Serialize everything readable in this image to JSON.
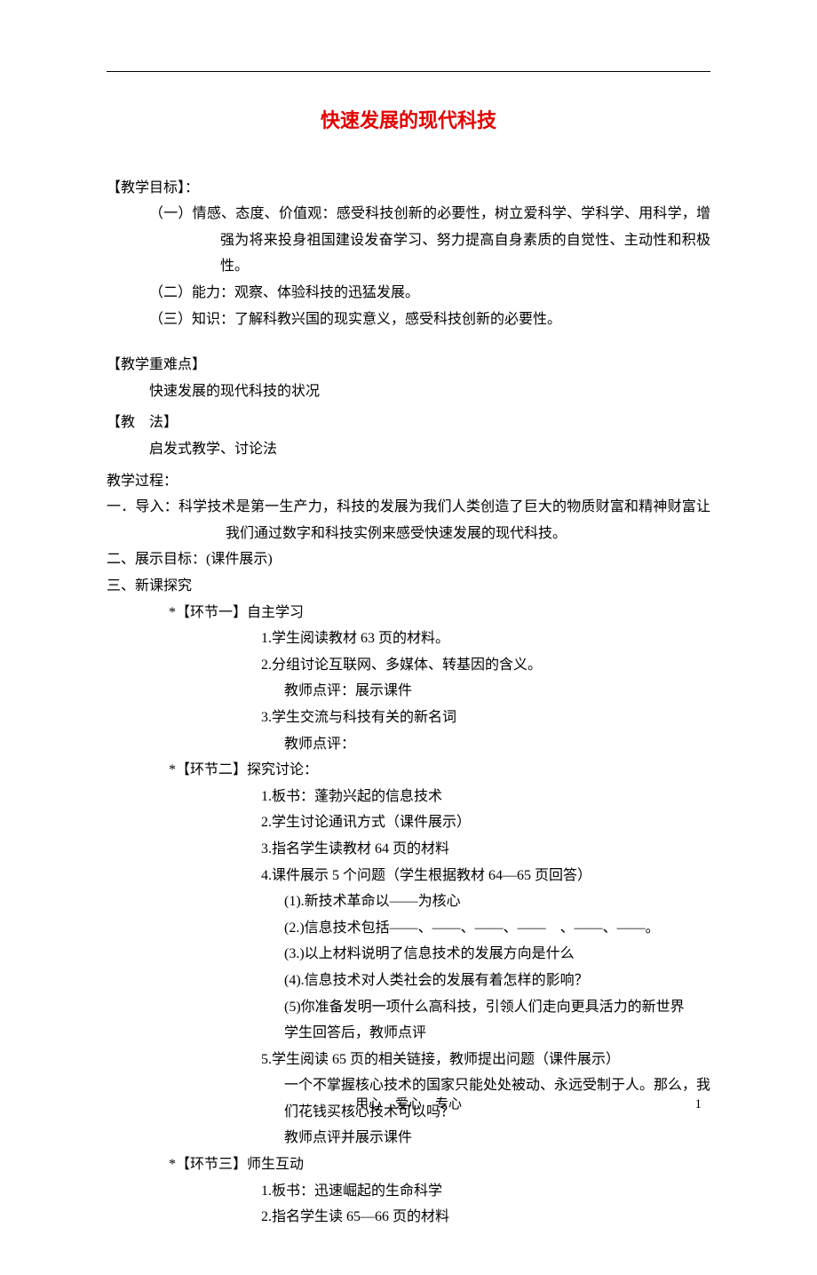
{
  "title": "快速发展的现代科技",
  "sections": {
    "goals_head": "【教学目标】：",
    "goal1": "（一）情感、态度、价值观：感受科技创新的必要性，树立爱科学、学科学、用科学，增强为将来投身祖国建设发奋学习、努力提高自身素质的自觉性、主动性和积极性。",
    "goal2": "（二）能力：观察、体验科技的迅猛发展。",
    "goal3": "（三）知识：了解科教兴国的现实意义，感受科技创新的必要性。",
    "difficulty_head": "【教学重难点】",
    "difficulty_body": "快速发展的现代科技的状况",
    "method_head": "【教　法】",
    "method_body": "启发式教学、讨论法",
    "process_head": "教学过程：",
    "intro": "一．导入：科学技术是第一生产力，科技的发展为我们人类创造了巨大的物质财富和精神财富让我们通过数字和科技实例来感受快速发展的现代科技。",
    "show_target": "二、展示目标：(课件展示)",
    "explore_head": "三、新课探究",
    "part1_head": "*【环节一】自主学习",
    "p1_1": "1.学生阅读教材 63 页的材料。",
    "p1_2": "2.分组讨论互联网、多媒体、转基因的含义。",
    "p1_2a": "教师点评：展示课件",
    "p1_3": "3.学生交流与科技有关的新名词",
    "p1_3a": "教师点评：",
    "part2_head": "*【环节二】探究讨论：",
    "p2_1": "1.板书：蓬勃兴起的信息技术",
    "p2_2": "2.学生讨论通讯方式（课件展示）",
    "p2_3": "3.指名学生读教材 64 页的材料",
    "p2_4": "4.课件展示 5 个问题（学生根据教材 64—65 页回答）",
    "p2_4_1": "(1).新技术革命以——为核心",
    "p2_4_2": "(2.)信息技术包括——、——、——、——　、——、——。",
    "p2_4_3": "(3.)以上材料说明了信息技术的发展方向是什么",
    "p2_4_4": "(4).信息技术对人类社会的发展有着怎样的影响？",
    "p2_4_5": "(5)你准备发明一项什么高科技，引领人们走向更具活力的新世界",
    "p2_4_6": "学生回答后，教师点评",
    "p2_5": "5.学生阅读 65 页的相关链接，教师提出问题（课件展示）",
    "p2_5a": "一个不掌握核心技术的国家只能处处被动、永远受制于人。那么，我们花钱买核心技术可以吗？",
    "p2_5b": "教师点评并展示课件",
    "part3_head": "*【环节三】师生互动",
    "p3_1": "1.板书：迅速崛起的生命科学",
    "p3_2": "2.指名学生读 65—66 页的材料"
  },
  "footer": "用心　爱心　专心",
  "page_num": "1"
}
